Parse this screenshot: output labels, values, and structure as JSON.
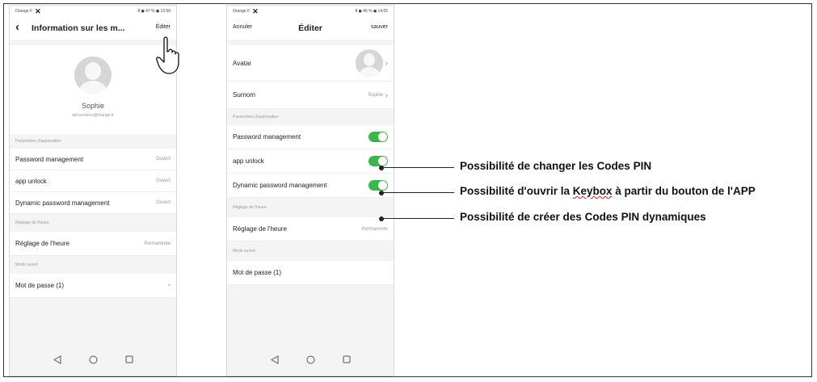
{
  "screen1": {
    "status_right": "8 ◼ 47 % ◼ 13:50",
    "status_left": "Orange F",
    "header_title": "Information sur les m...",
    "edit_label": "Éditer",
    "profile_name": "Sophie",
    "profile_email": "adi-services@orange.fr",
    "sections": [
      {
        "label": "Paramètres d'autorisation",
        "rows": [
          {
            "label": "Password management",
            "value": "Ouvert"
          },
          {
            "label": "app unlock",
            "value": "Ouvert"
          },
          {
            "label": "Dynamic password management",
            "value": "Ouvert"
          }
        ]
      },
      {
        "label": "Réglage de l'heure",
        "rows": [
          {
            "label": "Réglage de l'heure",
            "value": "Permanente"
          }
        ]
      },
      {
        "label": "Mode ouvert",
        "rows": [
          {
            "label": "Mot de passe (1)",
            "value": ">"
          }
        ]
      }
    ]
  },
  "screen2": {
    "status_right": "8 ◼ 46 % ◼ 14:05",
    "status_left": "Orange F",
    "cancel_label": "Annuler",
    "header_title": "Éditer",
    "save_label": "sauver",
    "avatar_label": "Avatar",
    "nickname_label": "Surnom",
    "nickname_value": "Sophie",
    "section_auth": "Paramètres d'autorisation",
    "toggle_rows": [
      "Password management",
      "app unlock",
      "Dynamic password management"
    ],
    "section_time": "Réglage de l'heure",
    "time_label": "Réglage de l'heure",
    "time_value": "Permanente",
    "section_mode": "Mode ouvert",
    "password_label": "Mot de passe (1)"
  },
  "annotations": {
    "change_pin": "Possibilité de changer les Codes PIN",
    "open_prefix": "Possibilité d'ouvrir la ",
    "open_keybox": "Keybox",
    "open_suffix": " à partir du bouton de l'APP",
    "dynamic_pin": "Possibilité de créer des Codes PIN dynamiques"
  },
  "colors": {
    "toggle_on": "#3cb54a",
    "spellcheck_underline": "#d02020"
  }
}
